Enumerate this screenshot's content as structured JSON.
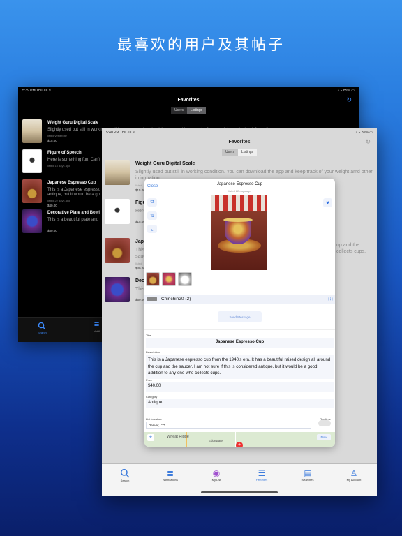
{
  "headline": "最喜欢的用户及其帖子",
  "colors": {
    "accent": "#3c7bdc",
    "heart": "#2f6fe0",
    "background_top": "#3a93ec",
    "background_bottom": "#0a1f6a"
  },
  "dark_ipad": {
    "time": "5:39 PM  Thu Jul 9",
    "battery": "85%",
    "title": "Favorites",
    "segments": [
      "Users",
      "Listings"
    ],
    "items": [
      {
        "title": "Weight Guru Digital Scale",
        "desc": "Slightly used but still in working condition. You can download the app and keep track of your weight amd other information.",
        "meta": "listed yesterday",
        "price": "$15.00"
      },
      {
        "title": "Figure of Speech",
        "desc": "Here is something fun. Can't",
        "meta": "listed 15 days ago",
        "price": "$15.00"
      },
      {
        "title": "Japanese Espresso Cup",
        "desc": "This is a Japanese espresso",
        "desc2": "antique, but it would be a go",
        "meta": "listed 22 days ago",
        "price": "$40.00"
      },
      {
        "title": "Decorative Plate and Bowl",
        "desc": "This is a beautiful plate and",
        "meta": "",
        "price": "$50.00"
      }
    ],
    "tabs": [
      {
        "label": "Search",
        "icon": "search-icon"
      },
      {
        "label": "Notifi",
        "icon": "notifications-icon"
      }
    ]
  },
  "light_ipad": {
    "time": "5:40 PM  Thu Jul 9",
    "battery": "85%",
    "title": "Favorites",
    "segments": [
      "Users",
      "Listings"
    ],
    "items": [
      {
        "title": "Weight Guru Digital Scale",
        "desc": "Slightly used but still in working condition. You can download the app and keep track of your weight amd other",
        "desc2": "information.",
        "meta": "listed",
        "price": "$15.00"
      },
      {
        "title": "Figu",
        "desc": "Here",
        "meta": "",
        "price": "$15.00"
      },
      {
        "title": "Japa",
        "desc": "This",
        "desc2": "sauc",
        "right1": "up and the",
        "right2": "collects cups.",
        "meta": "listed",
        "price": "$40.00"
      },
      {
        "title": "Deco",
        "desc": "This",
        "meta": "",
        "price": "$50.00"
      }
    ],
    "tabs": [
      {
        "label": "Search",
        "icon": "search-icon"
      },
      {
        "label": "Notifications",
        "icon": "notifications-icon"
      },
      {
        "label": "My List",
        "icon": "my-list-icon"
      },
      {
        "label": "Favorites",
        "icon": "favorites-icon"
      },
      {
        "label": "Searches",
        "icon": "searches-icon"
      },
      {
        "label": "My Account",
        "icon": "account-icon"
      }
    ]
  },
  "modal": {
    "close": "Close",
    "title": "Japanese Espresso Cup",
    "subtitle": "listed 22 days ago",
    "seller": "Chinchin20 (2)",
    "send_message": "Send Message",
    "title_label": "Title",
    "title_value": "Japanese Espresso Cup",
    "description_label": "Description",
    "description_value": "This is a Japanese espresso cup from the 1940's era.  It has a beautiful raised design all around the cup and the saucer.  I am not sure if this is considered antique, but it would be a good addition to any one who collects cups.",
    "price_label": "Price",
    "price_value": "$40.00",
    "category_label": "Category",
    "category_value": "Antique",
    "location_label": "List Location",
    "location_value": "Denver, CO",
    "realtime_label": "Realtime",
    "map_labels": [
      "Wheat Ridge",
      "Edgewater"
    ],
    "map_button": "Now"
  }
}
